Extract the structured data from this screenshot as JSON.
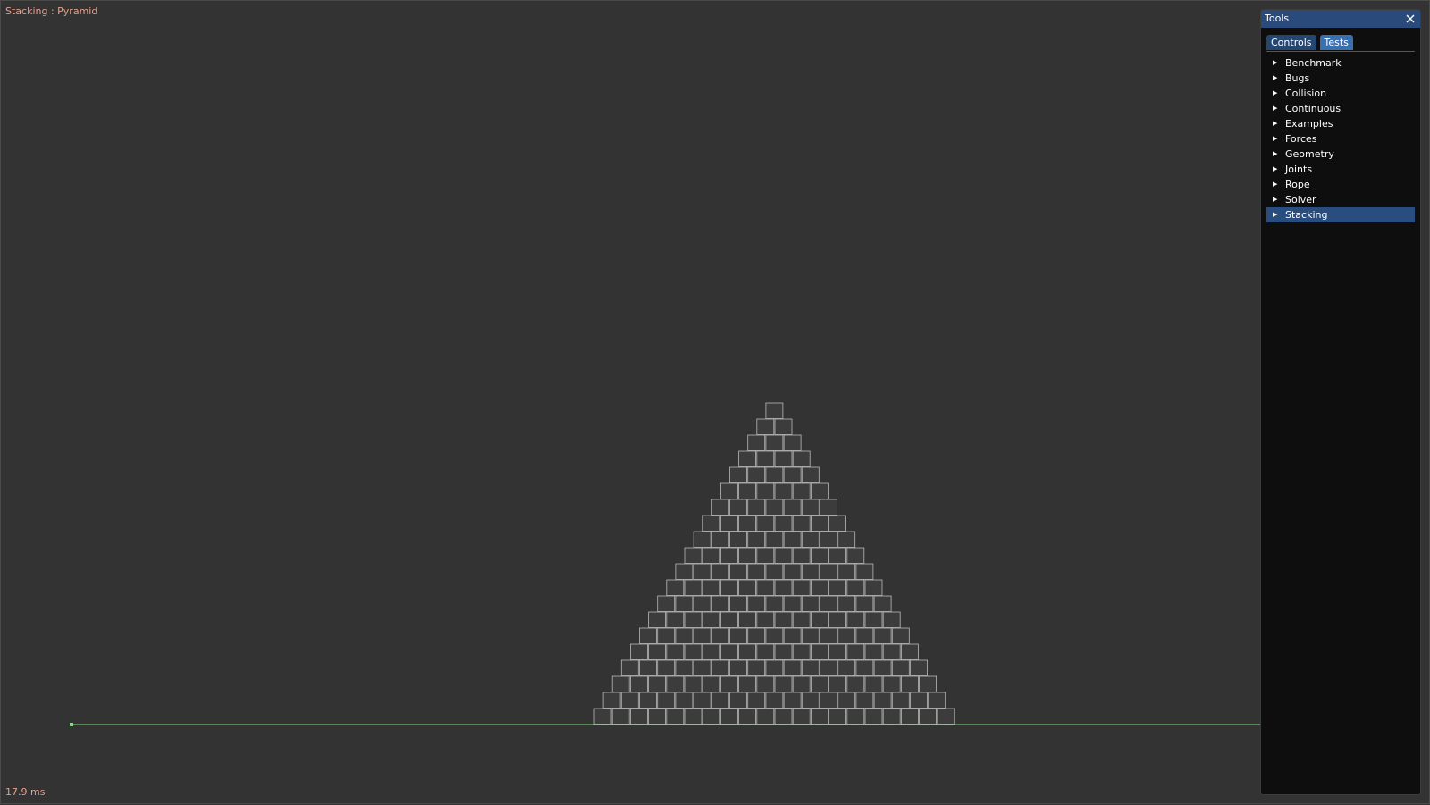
{
  "window": {
    "test_title": "Stacking : Pyramid",
    "frame_time": "17.9 ms"
  },
  "scene": {
    "pyramid_rows": 20,
    "colors": {
      "box_fill": "#3c3c3c",
      "box_stroke": "#b8b8b8",
      "ground": "#7fe07f",
      "background": "#333333"
    }
  },
  "tools": {
    "title": "Tools",
    "close_icon": "close-icon",
    "tabs": [
      {
        "label": "Controls",
        "active": false
      },
      {
        "label": "Tests",
        "active": true
      }
    ],
    "categories": [
      {
        "label": "Benchmark",
        "selected": false
      },
      {
        "label": "Bugs",
        "selected": false
      },
      {
        "label": "Collision",
        "selected": false
      },
      {
        "label": "Continuous",
        "selected": false
      },
      {
        "label": "Examples",
        "selected": false
      },
      {
        "label": "Forces",
        "selected": false
      },
      {
        "label": "Geometry",
        "selected": false
      },
      {
        "label": "Joints",
        "selected": false
      },
      {
        "label": "Rope",
        "selected": false
      },
      {
        "label": "Solver",
        "selected": false
      },
      {
        "label": "Stacking",
        "selected": true
      }
    ],
    "colors": {
      "titlebar": "#294a7a",
      "tab": "#244670",
      "tab_active": "#3a6fb0",
      "selection": "#284d7e"
    }
  }
}
